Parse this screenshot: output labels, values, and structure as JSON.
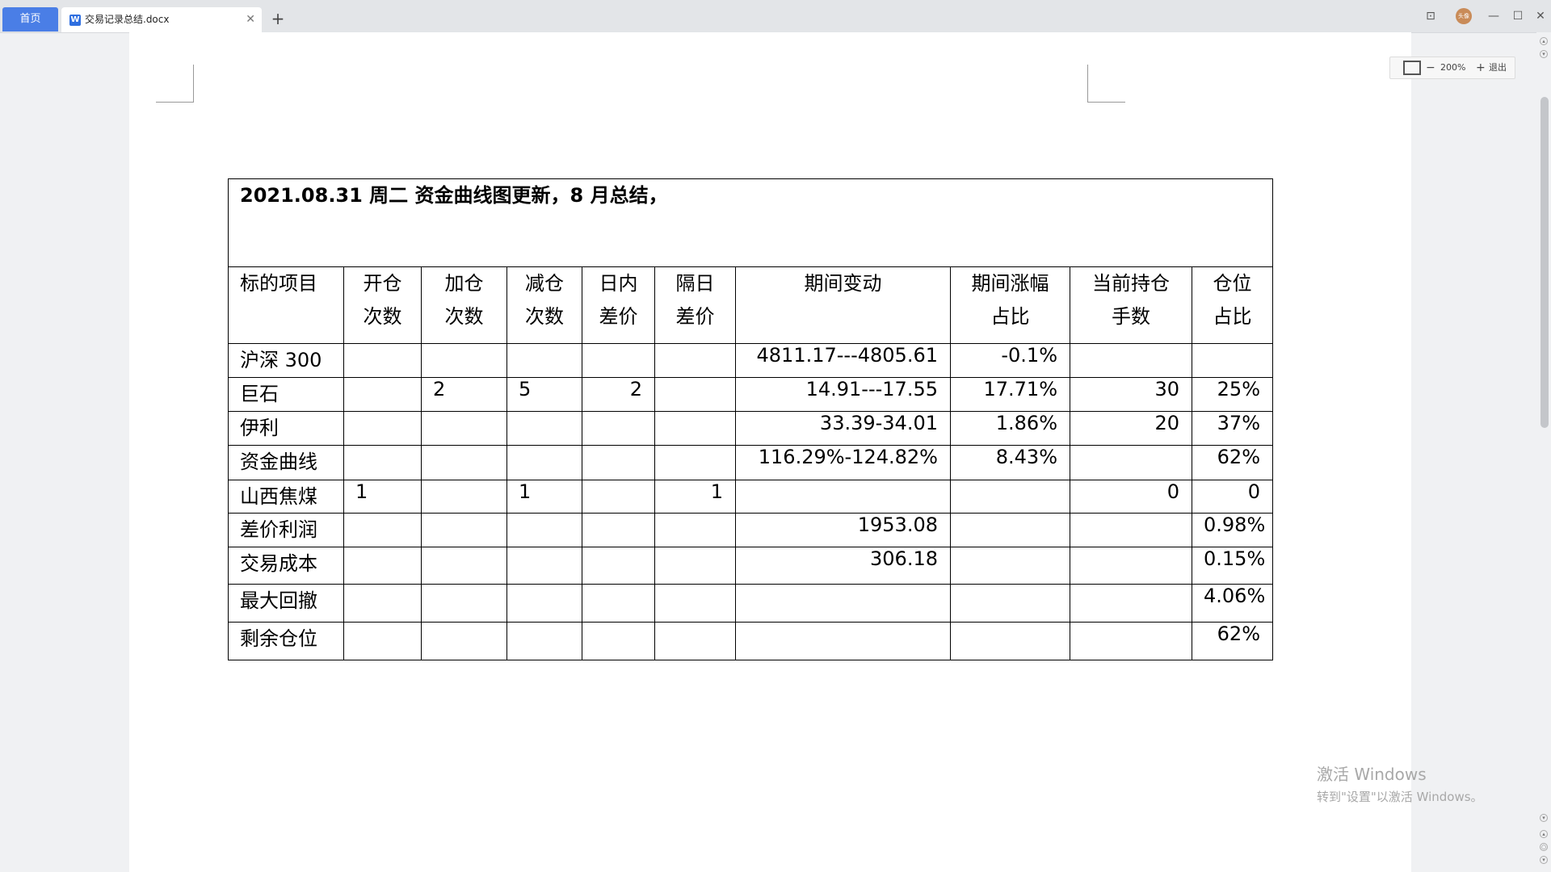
{
  "tabs": {
    "home_label": "首页",
    "doc_icon": "W",
    "doc_title": "交易记录总结.docx",
    "close": "✕",
    "new_tab": "+"
  },
  "window": {
    "layout_icon": "⊡",
    "avatar_text": "头像",
    "minimize": "—",
    "maximize": "☐",
    "close": "✕"
  },
  "zoom": {
    "fit": "",
    "minus": "−",
    "level": "200%",
    "plus": "+",
    "exit": "退出"
  },
  "document": {
    "heading": "2021.08.31  周二  资金曲线图更新，8 月总结，",
    "columns": [
      "标的项目",
      "开仓\n次数",
      "加仓\n次数",
      "减仓\n次数",
      "日内\n差价",
      "隔日\n差价",
      "期间变动",
      "期间涨幅\n占比",
      "当前持仓\n手数",
      "仓位\n占比"
    ],
    "rows": [
      {
        "name": "沪深 300",
        "open": "",
        "add": "",
        "reduce": "",
        "intraday": "",
        "overnight": "",
        "change": "4811.17---4805.61",
        "pct": "-0.1%",
        "hands": "",
        "position": ""
      },
      {
        "name": "巨石",
        "open": "",
        "add": "2",
        "reduce": "5",
        "intraday": "2",
        "overnight": "",
        "change": "14.91---17.55",
        "pct": "17.71%",
        "hands": "30",
        "position": "25%"
      },
      {
        "name": "伊利",
        "open": "",
        "add": "",
        "reduce": "",
        "intraday": "",
        "overnight": "",
        "change": "33.39-34.01",
        "pct": "1.86%",
        "hands": "20",
        "position": "37%"
      },
      {
        "name": "资金曲线",
        "open": "",
        "add": "",
        "reduce": "",
        "intraday": "",
        "overnight": "",
        "change": "116.29%-124.82%",
        "pct": "8.43%",
        "hands": "",
        "position": "62%"
      },
      {
        "name": "山西焦煤",
        "open": "1",
        "add": "",
        "reduce": "1",
        "intraday": "",
        "overnight": "1",
        "change": "",
        "pct": "",
        "hands": "0",
        "position": "0"
      },
      {
        "name": "差价利润",
        "open": "",
        "add": "",
        "reduce": "",
        "intraday": "",
        "overnight": "",
        "change": "1953.08",
        "pct": "",
        "hands": "",
        "position": "0.98%"
      },
      {
        "name": "交易成本",
        "open": "",
        "add": "",
        "reduce": "",
        "intraday": "",
        "overnight": "",
        "change": "306.18",
        "pct": "",
        "hands": "",
        "position": "0.15%"
      },
      {
        "name": "最大回撤",
        "open": "",
        "add": "",
        "reduce": "",
        "intraday": "",
        "overnight": "",
        "change": "",
        "pct": "",
        "hands": "",
        "position": "4.06%"
      },
      {
        "name": "剩余仓位",
        "open": "",
        "add": "",
        "reduce": "",
        "intraday": "",
        "overnight": "",
        "change": "",
        "pct": "",
        "hands": "",
        "position": "62%"
      }
    ]
  },
  "watermark": {
    "line1": "激活 Windows",
    "line2": "转到\"设置\"以激活 Windows。"
  }
}
